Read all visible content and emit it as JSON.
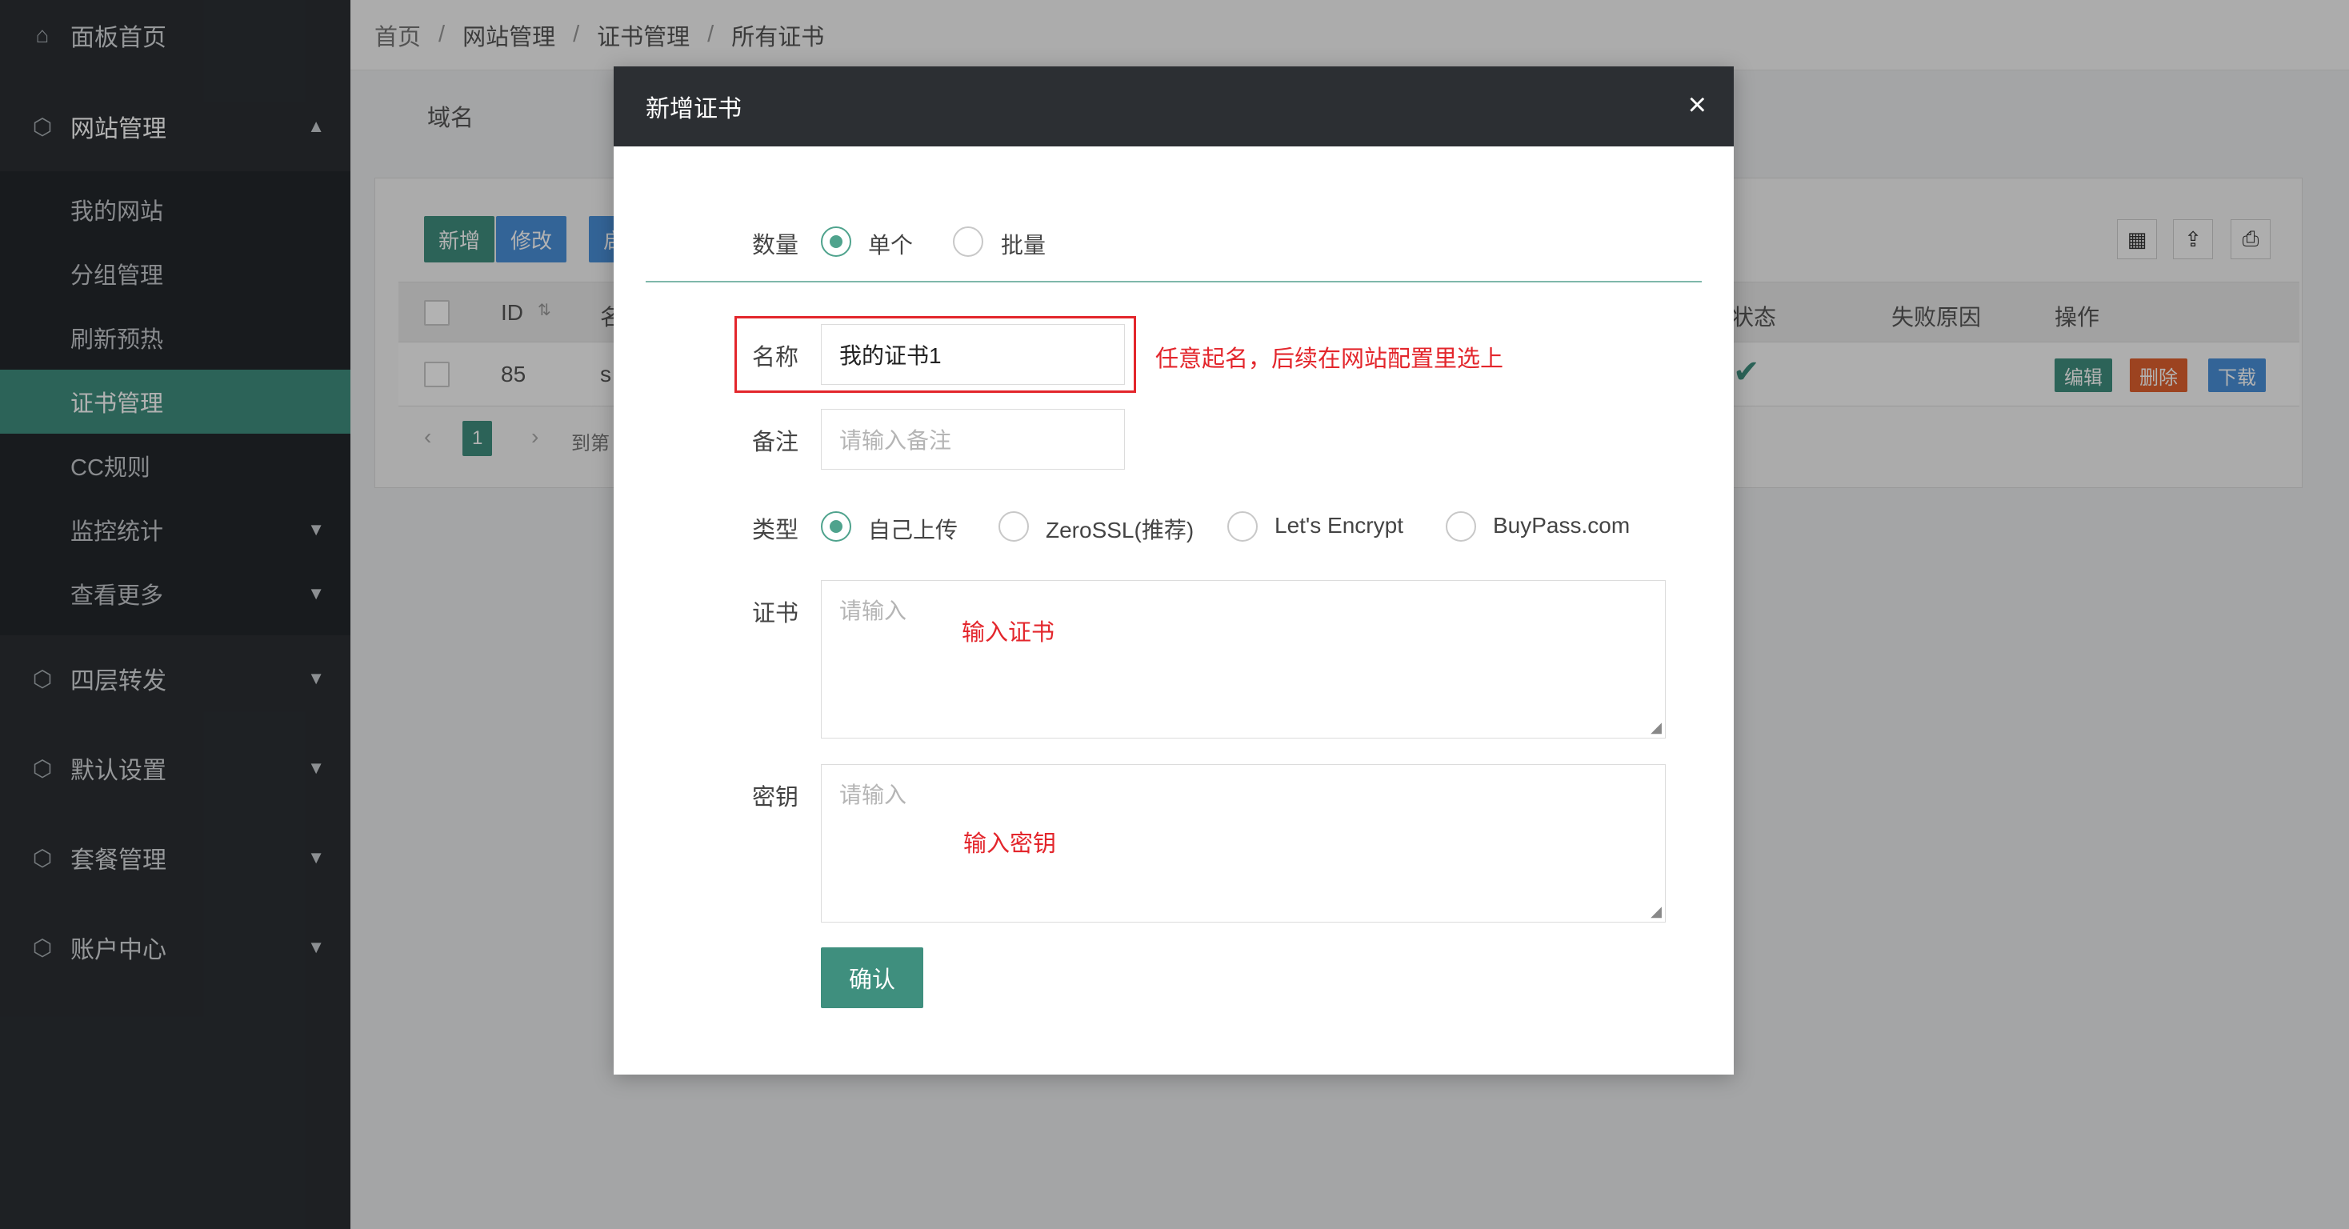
{
  "sidebar": {
    "items": [
      {
        "label": "面板首页",
        "icon": "home-icon"
      },
      {
        "label": "网站管理",
        "icon": "cube-icon"
      },
      {
        "label": "四层转发",
        "icon": "cube-icon"
      },
      {
        "label": "默认设置",
        "icon": "cube-icon"
      },
      {
        "label": "套餐管理",
        "icon": "cube-icon"
      },
      {
        "label": "账户中心",
        "icon": "cube-icon"
      }
    ],
    "submenu": [
      {
        "label": "我的网站"
      },
      {
        "label": "分组管理"
      },
      {
        "label": "刷新预热"
      },
      {
        "label": "证书管理"
      },
      {
        "label": "CC规则"
      },
      {
        "label": "监控统计"
      },
      {
        "label": "查看更多"
      }
    ]
  },
  "breadcrumb": [
    "首页",
    "网站管理",
    "证书管理",
    "所有证书"
  ],
  "filter": {
    "domain_label": "域名"
  },
  "toolbar": {
    "add": "新增",
    "edit": "修改",
    "more": "启"
  },
  "table": {
    "headers": {
      "id": "ID",
      "name": "名",
      "status": "状态",
      "fail_reason": "失败原因",
      "ops": "操作"
    },
    "row": {
      "id": "85",
      "name": "s",
      "edit": "编辑",
      "delete": "删除",
      "download": "下载"
    },
    "pager": {
      "page": "1",
      "goto": "到第"
    }
  },
  "modal": {
    "title": "新增证书",
    "quantity": {
      "label": "数量",
      "options": [
        "单个",
        "批量"
      ],
      "selected": "单个"
    },
    "name": {
      "label": "名称",
      "value": "我的证书1"
    },
    "remark": {
      "label": "备注",
      "placeholder": "请输入备注"
    },
    "type": {
      "label": "类型",
      "options": [
        "自己上传",
        "ZeroSSL(推荐)",
        "Let's Encrypt",
        "BuyPass.com"
      ],
      "selected": "自己上传"
    },
    "cert": {
      "label": "证书",
      "placeholder": "请输入"
    },
    "key": {
      "label": "密钥",
      "placeholder": "请输入"
    },
    "confirm": "确认"
  },
  "annotations": {
    "name_hint": "任意起名，后续在网站配置里选上",
    "cert_hint": "输入证书",
    "key_hint": "输入密钥"
  },
  "colors": {
    "accent": "#3f8f7e",
    "annotation": "#e3262c",
    "sidebar": "#2b2f33"
  }
}
